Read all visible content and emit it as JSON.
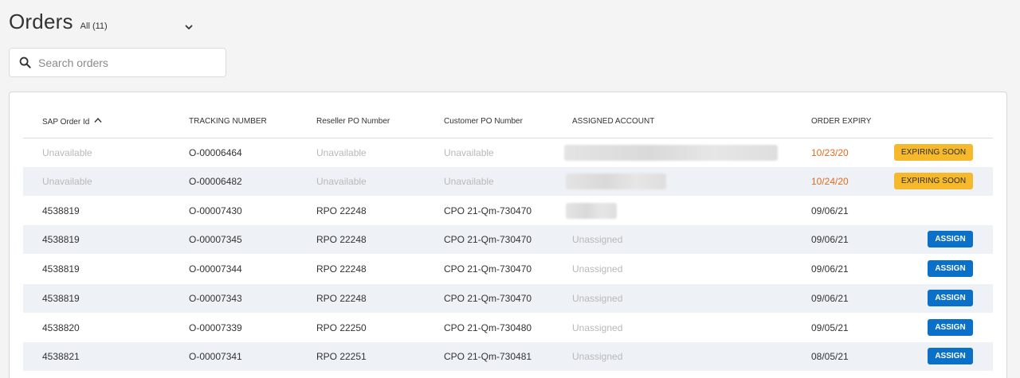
{
  "page": {
    "title": "Orders",
    "filter_label": "All (11)"
  },
  "search": {
    "placeholder": "Search orders",
    "value": ""
  },
  "table": {
    "columns": {
      "sap_order_id": "SAP Order Id",
      "tracking_number": "TRACKING NUMBER",
      "reseller_po": "Reseller PO Number",
      "customer_po": "Customer PO Number",
      "assigned_account": "ASSIGNED ACCOUNT",
      "order_expiry": "ORDER EXPIRY"
    },
    "rows": [
      {
        "sap": "Unavailable",
        "tracking": "O-00006464",
        "reseller": "Unavailable",
        "customer": "Unavailable",
        "account": "",
        "expiry": "10/23/20",
        "action": "EXPIRING SOON"
      },
      {
        "sap": "Unavailable",
        "tracking": "O-00006482",
        "reseller": "Unavailable",
        "customer": "Unavailable",
        "account": "",
        "expiry": "10/24/20",
        "action": "EXPIRING SOON"
      },
      {
        "sap": "4538819",
        "tracking": "O-00007430",
        "reseller": "RPO 22248",
        "customer": "CPO 21-Qm-730470",
        "account": "",
        "expiry": "09/06/21",
        "action": ""
      },
      {
        "sap": "4538819",
        "tracking": "O-00007345",
        "reseller": "RPO 22248",
        "customer": "CPO 21-Qm-730470",
        "account": "Unassigned",
        "expiry": "09/06/21",
        "action": "ASSIGN"
      },
      {
        "sap": "4538819",
        "tracking": "O-00007344",
        "reseller": "RPO 22248",
        "customer": "CPO 21-Qm-730470",
        "account": "Unassigned",
        "expiry": "09/06/21",
        "action": "ASSIGN"
      },
      {
        "sap": "4538819",
        "tracking": "O-00007343",
        "reseller": "RPO 22248",
        "customer": "CPO 21-Qm-730470",
        "account": "Unassigned",
        "expiry": "09/06/21",
        "action": "ASSIGN"
      },
      {
        "sap": "4538820",
        "tracking": "O-00007339",
        "reseller": "RPO 22250",
        "customer": "CPO 21-Qm-730480",
        "account": "Unassigned",
        "expiry": "09/05/21",
        "action": "ASSIGN"
      },
      {
        "sap": "4538821",
        "tracking": "O-00007341",
        "reseller": "RPO 22251",
        "customer": "CPO 21-Qm-730481",
        "account": "Unassigned",
        "expiry": "08/05/21",
        "action": "ASSIGN"
      }
    ]
  },
  "colors": {
    "assign": "#0a70c8",
    "expiring_badge": "#f6b92b",
    "expiry_warning": "#e56a1f",
    "alt_row": "#eef2f6"
  },
  "icons": {
    "search": "search-icon",
    "dropdown": "chevron-down-icon",
    "sort": "sort-ascending-icon"
  }
}
